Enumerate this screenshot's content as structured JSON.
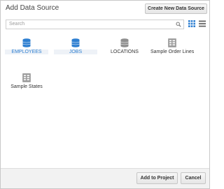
{
  "dialog": {
    "title": "Add Data Source",
    "create_button": "Create New Data Source"
  },
  "search": {
    "placeholder": "Search"
  },
  "items": [
    {
      "label": "EMPLOYEES",
      "icon": "database-icon",
      "color": "#2e7fd1",
      "selected": true
    },
    {
      "label": "JOBS",
      "icon": "database-icon",
      "color": "#2e7fd1",
      "selected": true
    },
    {
      "label": "LOCATIONS",
      "icon": "database-icon",
      "color": "#8f8f8f",
      "selected": false
    },
    {
      "label": "Sample Order Lines",
      "icon": "spreadsheet-icon",
      "color": "#8f8f8f",
      "selected": false
    },
    {
      "label": "Sample States",
      "icon": "spreadsheet-icon",
      "color": "#8f8f8f",
      "selected": false
    }
  ],
  "footer": {
    "add_button": "Add to Project",
    "cancel_button": "Cancel"
  },
  "colors": {
    "accent": "#2e7fd1",
    "inactive_icon": "#8f8f8f"
  }
}
